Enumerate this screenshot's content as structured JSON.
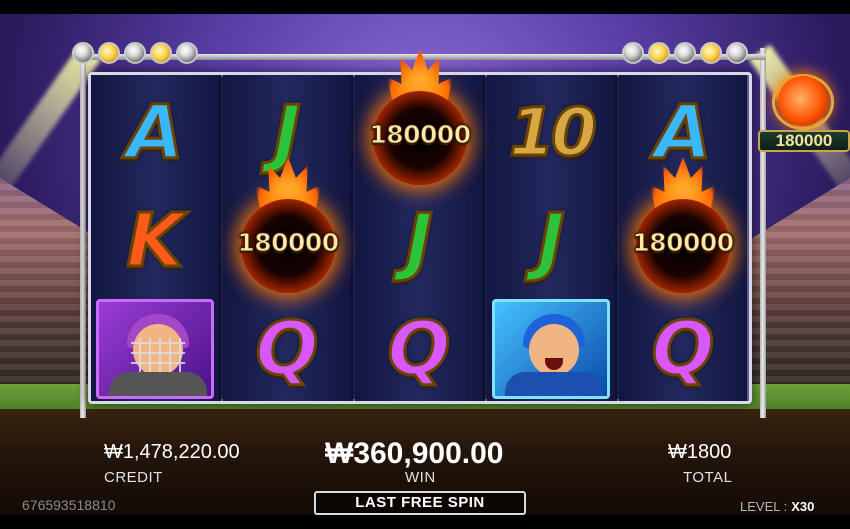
{
  "reels": [
    [
      "A",
      "K",
      "catcher"
    ],
    [
      "J",
      "fireball",
      "Q"
    ],
    [
      "fireball",
      "J",
      "Q"
    ],
    [
      "10",
      "J",
      "pitcher"
    ],
    [
      "A",
      "fireball",
      "Q"
    ]
  ],
  "fireball_values": {
    "reel2": "180000",
    "reel3": "180000",
    "reel5": "180000"
  },
  "side_jackpot": {
    "value": "180000",
    "icon": "fireball-icon"
  },
  "bottom": {
    "credit_value": "₩1,478,220.00",
    "credit_label": "CREDIT",
    "win_value": "₩360,900.00",
    "win_label": "WIN",
    "total_value": "₩1800",
    "total_label": "TOTAL",
    "spin_label": "LAST FREE SPIN",
    "round_id": "676593518810",
    "level_label": "LEVEL :",
    "level_value": "X30"
  },
  "colors": {
    "symbol_A": "#3ab8ff",
    "symbol_K": "#ff5a1a",
    "symbol_J": "#2cc33a",
    "symbol_Q": "#d857ff",
    "symbol_10": "#d6a743",
    "fire": "#ff8a00"
  }
}
